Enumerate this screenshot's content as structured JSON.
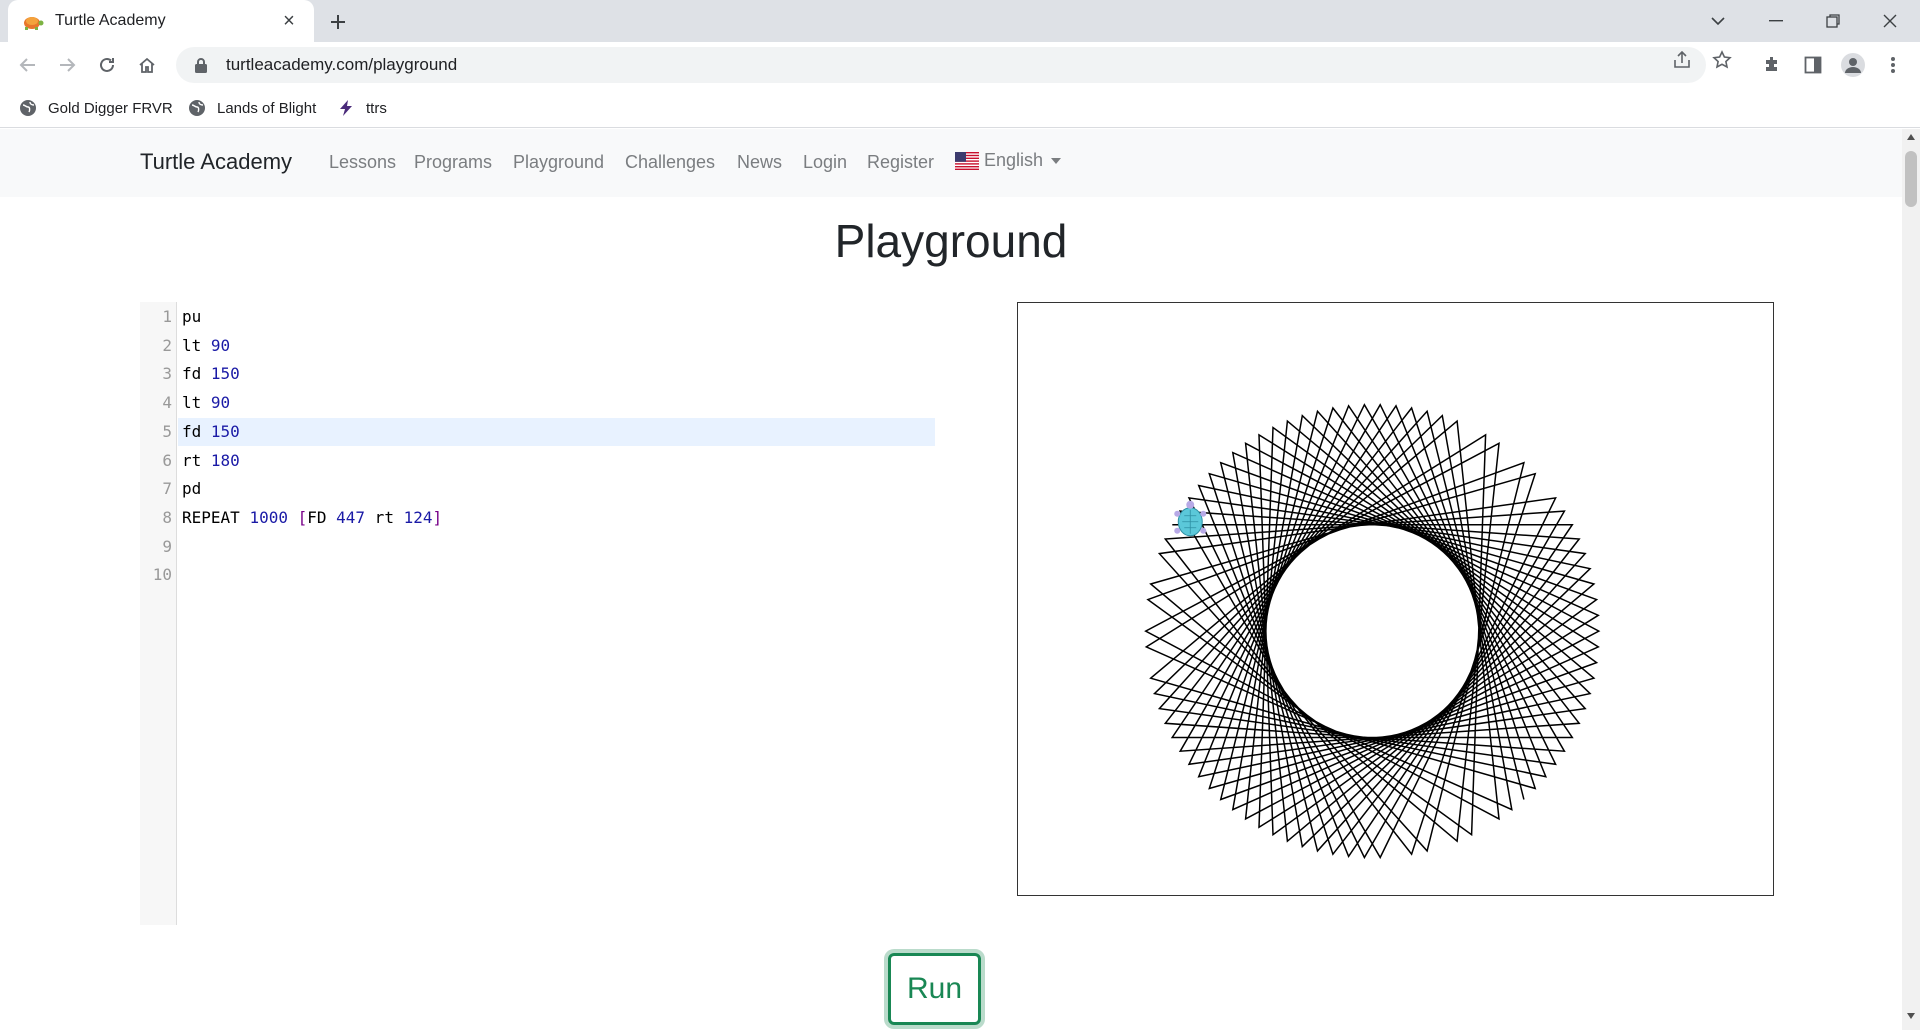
{
  "browser": {
    "tab_title": "Turtle Academy",
    "url": "turtleacademy.com/playground",
    "bookmarks": [
      "Gold Digger FRVR",
      "Lands of Blight",
      "ttrs"
    ]
  },
  "site": {
    "brand": "Turtle Academy",
    "nav": [
      "Lessons",
      "Programs",
      "Playground",
      "Challenges",
      "News",
      "Login",
      "Register"
    ],
    "language": "English"
  },
  "page": {
    "title": "Playground",
    "run_label": "Run"
  },
  "editor": {
    "active_line": 5,
    "lines": [
      [
        {
          "t": "pu",
          "k": "kw"
        }
      ],
      [
        {
          "t": "lt ",
          "k": "kw"
        },
        {
          "t": "90",
          "k": "num"
        }
      ],
      [
        {
          "t": "fd ",
          "k": "kw"
        },
        {
          "t": "150",
          "k": "num"
        }
      ],
      [
        {
          "t": "lt ",
          "k": "kw"
        },
        {
          "t": "90",
          "k": "num"
        }
      ],
      [
        {
          "t": "fd ",
          "k": "kw"
        },
        {
          "t": "150",
          "k": "num"
        }
      ],
      [
        {
          "t": "rt ",
          "k": "kw"
        },
        {
          "t": "180",
          "k": "num"
        }
      ],
      [
        {
          "t": "pd",
          "k": "kw"
        }
      ],
      [
        {
          "t": "REPEAT ",
          "k": "kw"
        },
        {
          "t": "1000",
          "k": "num"
        },
        {
          "t": " [",
          "k": "br"
        },
        {
          "t": "FD ",
          "k": "kw"
        },
        {
          "t": "447",
          "k": "num"
        },
        {
          "t": " rt ",
          "k": "kw"
        },
        {
          "t": "124",
          "k": "num"
        },
        {
          "t": "]",
          "k": "br"
        }
      ],
      [],
      []
    ]
  },
  "drawing": {
    "forward": 447,
    "turn": 124,
    "repeats": 1000,
    "stroke_color": "#000000",
    "turtle_color": "#5bc8d9"
  },
  "colors": {
    "accent": "#198754",
    "tab_strip": "#dee1e6",
    "site_nav_bg": "#f8f9fa",
    "active_line": "#e8f2ff"
  }
}
